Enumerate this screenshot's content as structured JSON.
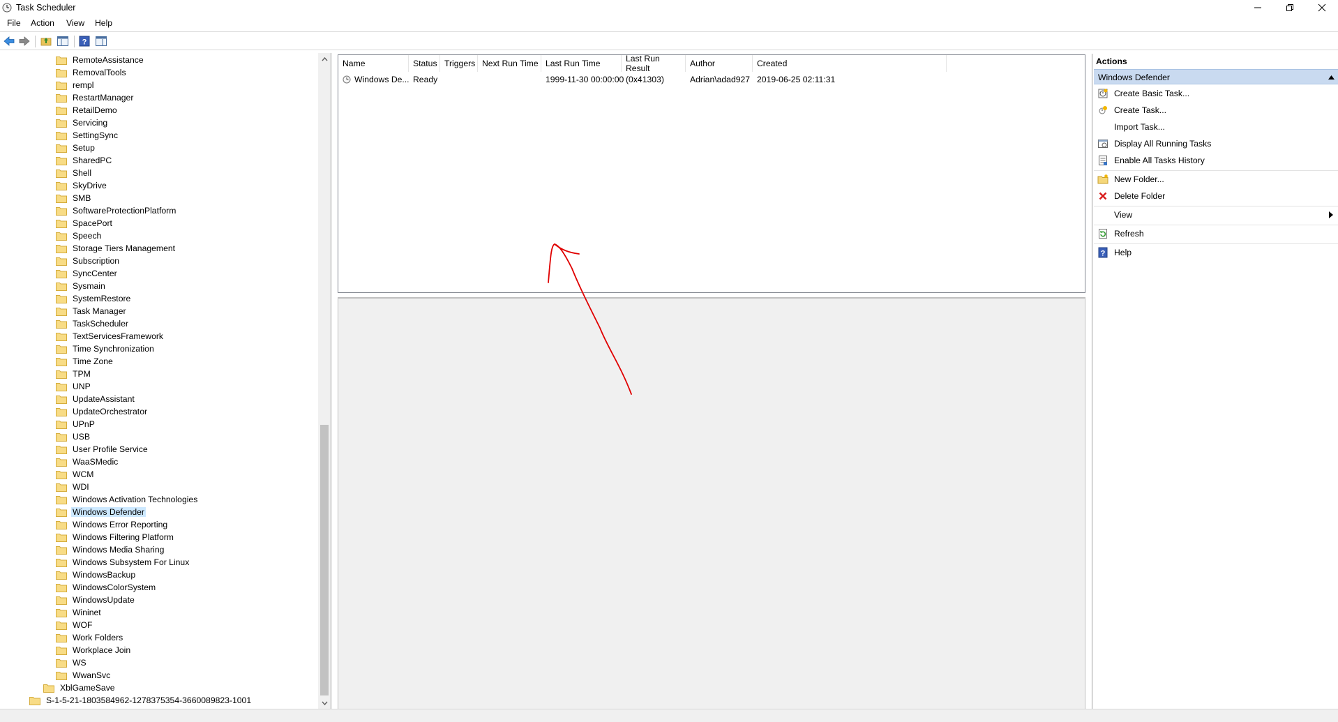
{
  "window": {
    "title": "Task Scheduler",
    "icon": "clock-icon"
  },
  "menu": [
    "File",
    "Action",
    "View",
    "Help"
  ],
  "tree": {
    "items": [
      "RemoteAssistance",
      "RemovalTools",
      "rempl",
      "RestartManager",
      "RetailDemo",
      "Servicing",
      "SettingSync",
      "Setup",
      "SharedPC",
      "Shell",
      "SkyDrive",
      "SMB",
      "SoftwareProtectionPlatform",
      "SpacePort",
      "Speech",
      "Storage Tiers Management",
      "Subscription",
      "SyncCenter",
      "Sysmain",
      "SystemRestore",
      "Task Manager",
      "TaskScheduler",
      "TextServicesFramework",
      "Time Synchronization",
      "Time Zone",
      "TPM",
      "UNP",
      "UpdateAssistant",
      "UpdateOrchestrator",
      "UPnP",
      "USB",
      "User Profile Service",
      "WaaSMedic",
      "WCM",
      "WDI",
      "Windows Activation Technologies",
      "Windows Defender",
      "Windows Error Reporting",
      "Windows Filtering Platform",
      "Windows Media Sharing",
      "Windows Subsystem For Linux",
      "WindowsBackup",
      "WindowsColorSystem",
      "WindowsUpdate",
      "Wininet",
      "WOF",
      "Work Folders",
      "Workplace Join",
      "WS",
      "WwanSvc"
    ],
    "selected": "Windows Defender",
    "parent_items": [
      "XblGameSave"
    ],
    "root_items": [
      "S-1-5-21-1803584962-1278375354-3660089823-1001"
    ]
  },
  "task_list": {
    "columns": [
      "Name",
      "Status",
      "Triggers",
      "Next Run Time",
      "Last Run Time",
      "Last Run Result",
      "Author",
      "Created"
    ],
    "rows": [
      {
        "name": "Windows De...",
        "status": "Ready",
        "triggers": "",
        "next_run_time": "",
        "last_run_time": "1999-11-30 00:00:00",
        "last_run_result": "(0x41303)",
        "author": "Adrian\\adad927",
        "created": "2019-06-25 02:11:31"
      }
    ]
  },
  "actions": {
    "title": "Actions",
    "section": "Windows Defender",
    "items": [
      {
        "label": "Create Basic Task...",
        "icon": "create-basic-task-icon"
      },
      {
        "label": "Create Task...",
        "icon": "create-task-icon"
      },
      {
        "label": "Import Task...",
        "icon": "none"
      },
      {
        "label": "Display All Running Tasks",
        "icon": "running-tasks-icon"
      },
      {
        "label": "Enable All Tasks History",
        "icon": "history-icon"
      },
      {
        "label": "New Folder...",
        "icon": "new-folder-icon"
      },
      {
        "label": "Delete Folder",
        "icon": "delete-icon"
      },
      {
        "label": "View",
        "icon": "none"
      },
      {
        "label": "Refresh",
        "icon": "refresh-icon"
      },
      {
        "label": "Help",
        "icon": "help-icon"
      }
    ]
  },
  "colors": {
    "selection": "#cce8ff",
    "actions_header": "#c9daf0",
    "annotation": "#e00000"
  }
}
